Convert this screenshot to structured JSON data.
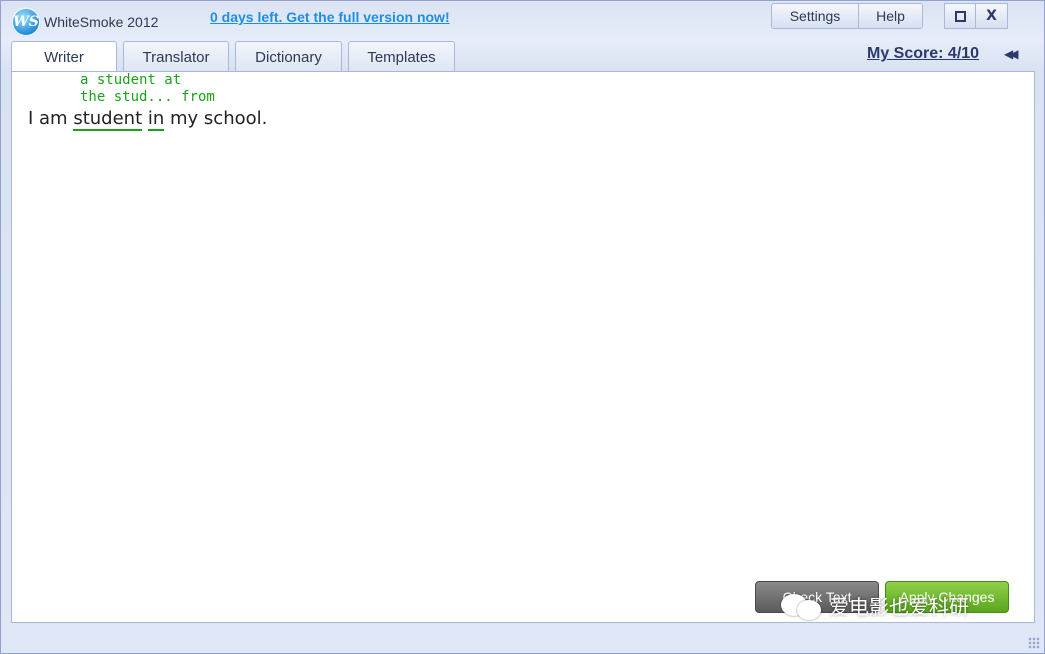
{
  "app": {
    "title": "WhiteSmoke 2012",
    "logo_text": "WS",
    "promo": "0 days left. Get the full version now!"
  },
  "toolbar": {
    "settings": "Settings",
    "help": "Help",
    "close": "X"
  },
  "tabs": [
    {
      "label": "Writer",
      "active": true
    },
    {
      "label": "Translator",
      "active": false
    },
    {
      "label": "Dictionary",
      "active": false
    },
    {
      "label": "Templates",
      "active": false
    }
  ],
  "score": "My Score: 4/10",
  "icons": {
    "collapse": "double-chevron-left-icon",
    "maximize": "square-icon",
    "close": "x-icon"
  },
  "editor": {
    "suggestions": [
      "a student at",
      "the stud... from"
    ],
    "text_parts": [
      "I am ",
      "student",
      " ",
      "in",
      " my school."
    ]
  },
  "buttons": {
    "check": "Check Text",
    "apply": "Apply Changes"
  },
  "watermark": "爱电影也爱科研",
  "colors": {
    "accent_link": "#1e8fe0",
    "suggestion_green": "#1aa31a",
    "apply_green": "#5aa51e"
  }
}
